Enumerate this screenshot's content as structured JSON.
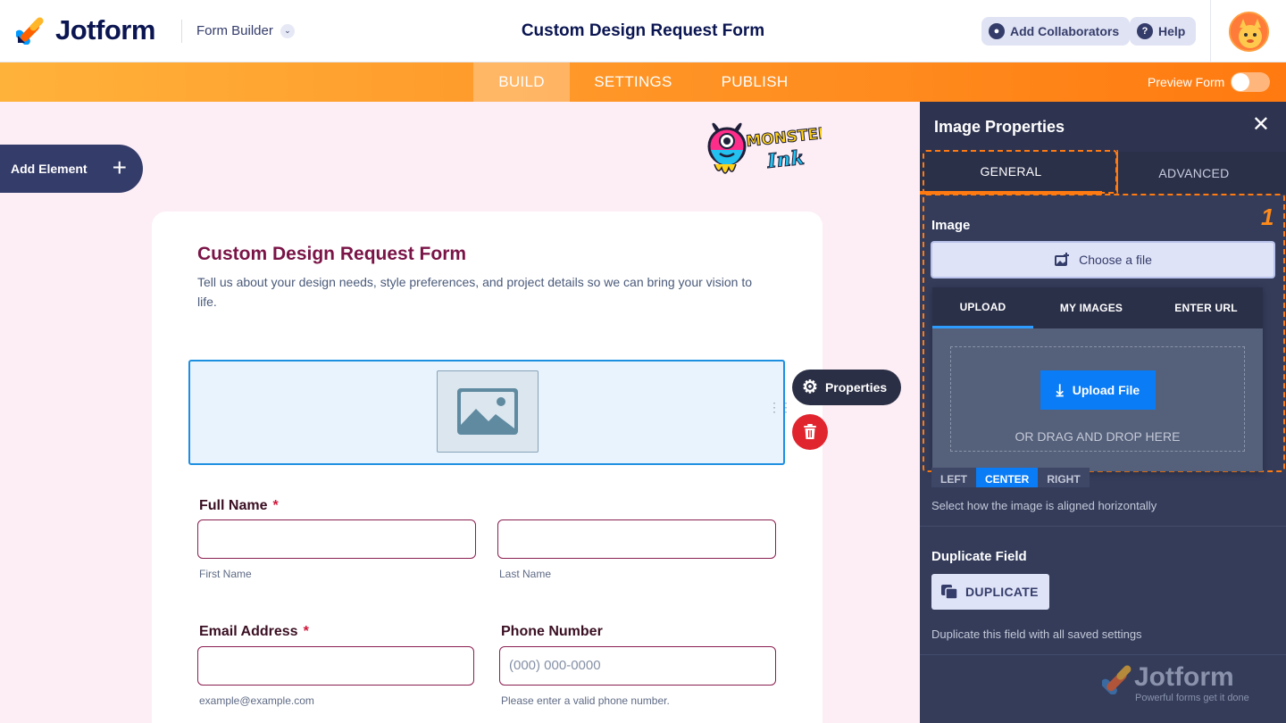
{
  "app": {
    "brand": "Jotform",
    "mode_label": "Form Builder",
    "form_title": "Custom Design Request Form",
    "add_collaborators": "Add Collaborators",
    "help": "Help"
  },
  "nav": {
    "tabs": [
      {
        "label": "BUILD",
        "active": true
      },
      {
        "label": "SETTINGS",
        "active": false
      },
      {
        "label": "PUBLISH",
        "active": false
      }
    ],
    "preview_label": "Preview Form",
    "preview_on": false
  },
  "canvas": {
    "add_element": "Add Element",
    "form": {
      "title": "Custom Design Request Form",
      "description": "Tell us about your design needs, style preferences, and project details so we can bring your vision to life.",
      "fields": {
        "full_name": {
          "label": "Full Name",
          "required_mark": "*",
          "first_sub": "First Name",
          "last_sub": "Last Name"
        },
        "email": {
          "label": "Email Address",
          "required_mark": "*",
          "sub": "example@example.com"
        },
        "phone": {
          "label": "Phone Number",
          "placeholder": "(000) 000-0000",
          "sub": "Please enter a valid phone number."
        }
      }
    },
    "field_toolbar": {
      "properties": "Properties"
    }
  },
  "panel": {
    "title": "Image Properties",
    "tabs": {
      "general": "GENERAL",
      "advanced": "ADVANCED"
    },
    "step_number": "1",
    "image_label": "Image",
    "choose_file": "Choose a file",
    "upload_tabs": [
      {
        "label": "UPLOAD",
        "active": true
      },
      {
        "label": "MY IMAGES",
        "active": false
      },
      {
        "label": "ENTER URL",
        "active": false
      }
    ],
    "upload_button": "Upload File",
    "drag_drop": "OR DRAG AND DROP HERE",
    "alignment": {
      "options": [
        "LEFT",
        "CENTER",
        "RIGHT"
      ],
      "selected": "CENTER",
      "hint": "Select how the image is aligned horizontally"
    },
    "duplicate": {
      "label": "Duplicate Field",
      "button": "DUPLICATE",
      "hint": "Duplicate this field with all saved settings"
    },
    "footer": {
      "brand": "Jotform",
      "tagline": "Powerful forms get it done"
    }
  },
  "colors": {
    "accent_orange": "#ff7a10",
    "brand_navy": "#0a1551",
    "panel_bg": "#343c5a",
    "upload_blue": "#0a7cf5",
    "danger_red": "#e0252f"
  }
}
